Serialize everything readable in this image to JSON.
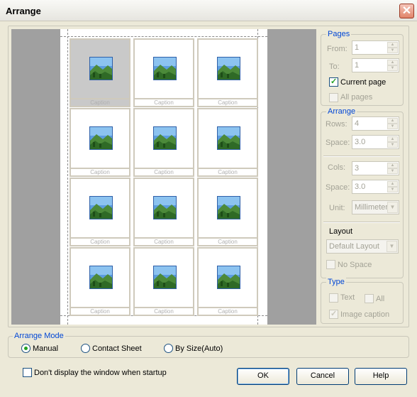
{
  "window": {
    "title": "Arrange",
    "close_glyph": "✕"
  },
  "preview": {
    "captions": [
      "Caption",
      "Caption",
      "Caption",
      "Caption",
      "Caption",
      "Caption",
      "Caption",
      "Caption",
      "Caption",
      "Caption",
      "Caption",
      "Caption"
    ],
    "selected_index": 0
  },
  "pages": {
    "legend": "Pages",
    "from_label": "From:",
    "from_value": "1",
    "to_label": "To:",
    "to_value": "1",
    "current_page_label": "Current page",
    "current_page_checked": true,
    "all_pages_label": "All pages",
    "all_pages_checked": false
  },
  "arrange": {
    "legend": "Arrange",
    "rows_label": "Rows:",
    "rows_value": "4",
    "row_space_label": "Space:",
    "row_space_value": "3.0",
    "cols_label": "Cols:",
    "cols_value": "3",
    "col_space_label": "Space:",
    "col_space_value": "3.0",
    "unit_label": "Unit:",
    "unit_value": "Millimeter",
    "layout_label": "Layout",
    "layout_value": "Default Layout",
    "no_space_label": "No Space",
    "no_space_checked": false
  },
  "type": {
    "legend": "Type",
    "text_label": "Text",
    "text_checked": false,
    "all_label": "All",
    "all_checked": false,
    "image_caption_label": "Image caption",
    "image_caption_checked": true
  },
  "arrange_mode": {
    "legend": "Arrange Mode",
    "options": [
      "Manual",
      "Contact Sheet",
      "By Size(Auto)"
    ],
    "selected": "Manual"
  },
  "startup_checkbox_label": "Don't display the window when startup",
  "buttons": {
    "ok": "OK",
    "cancel": "Cancel",
    "help": "Help"
  },
  "icons": {
    "thumbnail": "landscape-image-icon",
    "spin": "spin-arrows-icon",
    "dropdown": "chevron-down-icon"
  },
  "colors": {
    "accent": "#0046d5",
    "check": "#21a121",
    "preview_bg": "#a0a0a0",
    "dialog_bg": "#ece9d8"
  }
}
